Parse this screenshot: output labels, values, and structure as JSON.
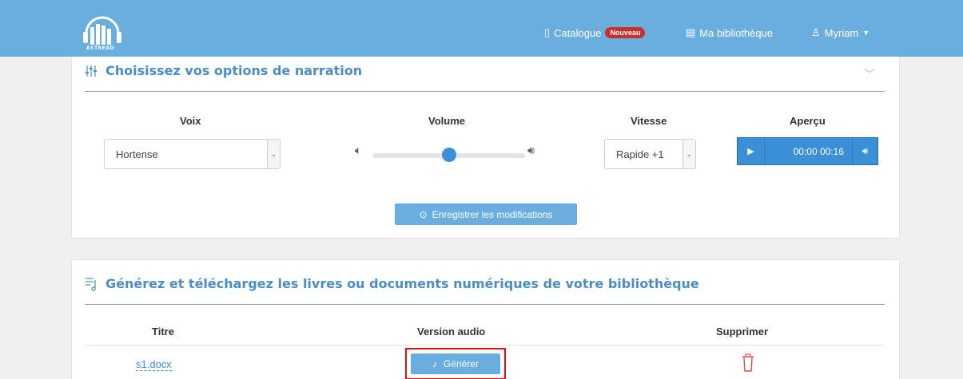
{
  "brand": {
    "logo_text": "ASTREAD"
  },
  "nav": {
    "catalogue": "Catalogue",
    "catalogue_badge": "Nouveau",
    "library": "Ma bibliothèque",
    "user": "Myriam"
  },
  "narration": {
    "title": "Choisissez vos options de narration",
    "voice_label": "Voix",
    "voice_value": "Hortense",
    "volume_label": "Volume",
    "volume_level": 0.5,
    "speed_label": "Vitesse",
    "speed_value": "Rapide +1",
    "preview_label": "Aperçu",
    "preview_time": "00:00 00:16",
    "save_label": "Enregistrer les modifications"
  },
  "library_section": {
    "title": "Générez et téléchargez les livres ou documents numériques de votre bibliothèque",
    "columns": [
      "Titre",
      "Version audio",
      "Supprimer"
    ],
    "rows": [
      {
        "title": "s1.docx",
        "action": "Générer"
      }
    ]
  },
  "colors": {
    "navbar": "#6aaee0",
    "accent": "#3a8fd6",
    "badge": "#c9302c",
    "highlight_box": "#e01010",
    "delete": "#d9534f"
  }
}
